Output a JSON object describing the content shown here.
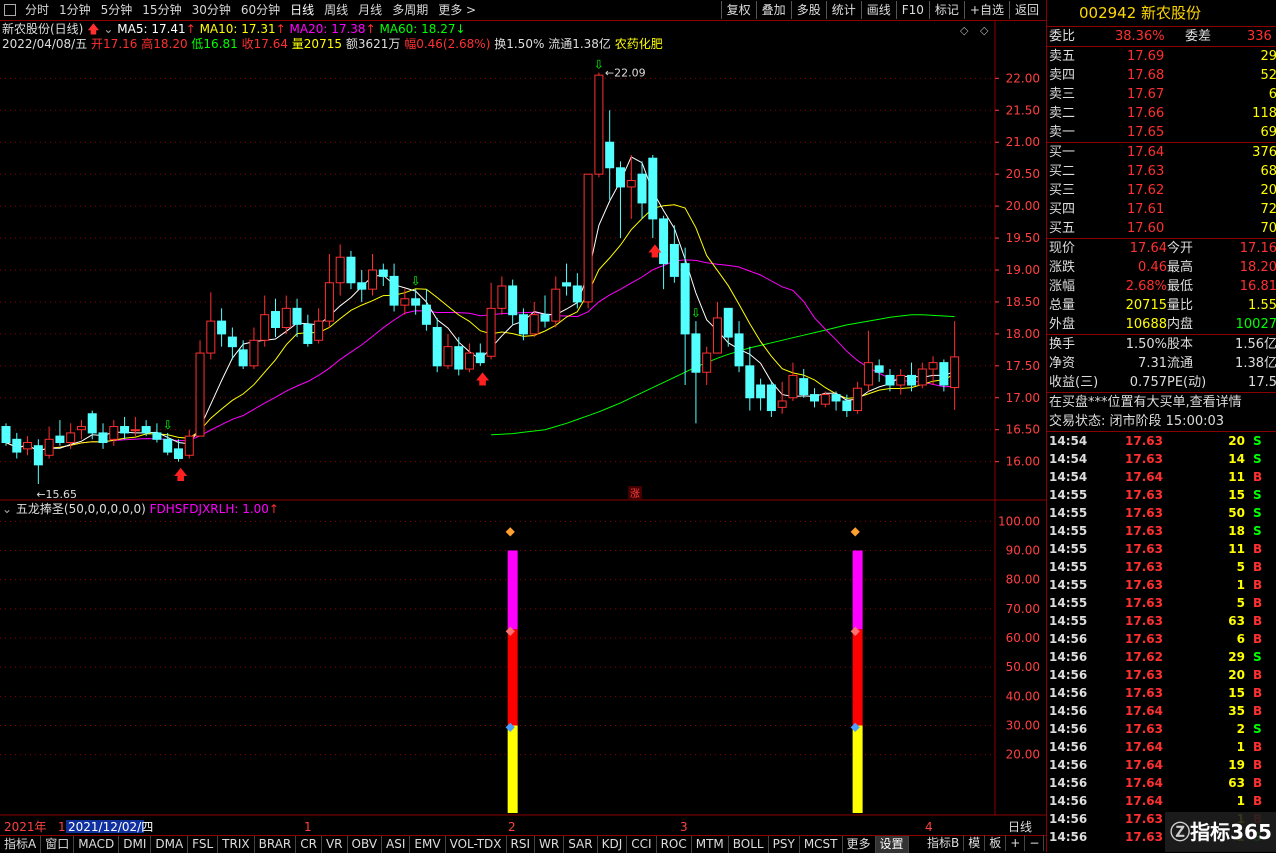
{
  "toolbar": {
    "periods": [
      "分时",
      "1分钟",
      "5分钟",
      "15分钟",
      "30分钟",
      "60分钟",
      "日线",
      "周线",
      "月线",
      "多周期",
      "更多"
    ],
    "active_period": "日线",
    "buttons": [
      "复权",
      "叠加",
      "多股",
      "统计",
      "画线",
      "F10",
      "标记",
      "+自选",
      "返回"
    ]
  },
  "chart_header": {
    "stock_label": "新农股份(日线)",
    "ma5": "MA5: 17.41",
    "ma10": "MA10: 17.31",
    "ma20": "MA20: 17.38",
    "ma60": "MA60: 18.27",
    "date": "2022/04/08/五",
    "open": "开17.16",
    "high": "高18.20",
    "low": "低16.81",
    "close": "收17.64",
    "vol": "量20715",
    "amount": "额3621万",
    "change": "幅0.46(2.68%)",
    "turnover": "换1.50%",
    "float": "流通1.38亿",
    "sector": "农药化肥"
  },
  "colors": {
    "up": "#ff3030",
    "down": "#54ffff",
    "ma5": "#ffffff",
    "ma10": "#ffff00",
    "ma20": "#ff00ff",
    "ma60": "#00ff00",
    "grid": "#8b0000",
    "axis": "#ff4040"
  },
  "price_axis": {
    "ticks": [
      22.0,
      21.5,
      21.0,
      20.5,
      20.0,
      19.5,
      19.0,
      18.5,
      18.0,
      17.5,
      17.0,
      16.5,
      16.0
    ],
    "max_label": "22.09",
    "min_label": "15.65"
  },
  "indicator": {
    "title": "五龙捧圣(50,0,0,0,0,0)",
    "value": "FDHSFDJXRLH: 1.00",
    "ticks": [
      100.0,
      90.0,
      80.0,
      70.0,
      60.0,
      50.0,
      40.0,
      30.0,
      20.0
    ],
    "bars": [
      {
        "index": 35,
        "yellow": [
          0,
          30
        ],
        "red": [
          30,
          63
        ],
        "magenta": [
          63,
          90
        ]
      },
      {
        "index": 67,
        "yellow": [
          0,
          30
        ],
        "red": [
          30,
          63
        ],
        "magenta": [
          63,
          90
        ]
      }
    ]
  },
  "chart_data": {
    "type": "candlestick",
    "candles": [
      [
        16.55,
        16.3,
        16.6,
        16.25
      ],
      [
        16.35,
        16.15,
        16.45,
        16.05
      ],
      [
        16.2,
        16.3,
        16.4,
        16.1
      ],
      [
        16.25,
        15.95,
        16.35,
        15.65
      ],
      [
        16.1,
        16.35,
        16.55,
        16.05
      ],
      [
        16.4,
        16.3,
        16.65,
        16.25
      ],
      [
        16.3,
        16.45,
        16.6,
        16.2
      ],
      [
        16.5,
        16.55,
        16.65,
        16.35
      ],
      [
        16.75,
        16.45,
        16.8,
        16.35
      ],
      [
        16.45,
        16.3,
        16.6,
        16.2
      ],
      [
        16.35,
        16.55,
        16.65,
        16.25
      ],
      [
        16.55,
        16.45,
        16.7,
        16.35
      ],
      [
        16.5,
        16.5,
        16.7,
        16.4
      ],
      [
        16.55,
        16.45,
        16.65,
        16.4
      ],
      [
        16.45,
        16.35,
        16.6,
        16.3
      ],
      [
        16.35,
        16.15,
        16.45,
        16.1
      ],
      [
        16.2,
        16.05,
        16.35,
        16.0
      ],
      [
        16.1,
        16.4,
        16.5,
        16.05
      ],
      [
        16.4,
        17.7,
        17.9,
        16.4
      ],
      [
        17.7,
        18.2,
        18.65,
        17.6
      ],
      [
        18.2,
        18.0,
        18.4,
        17.8
      ],
      [
        17.95,
        17.8,
        18.1,
        17.6
      ],
      [
        17.75,
        17.5,
        17.9,
        17.45
      ],
      [
        17.5,
        17.9,
        18.1,
        17.45
      ],
      [
        17.9,
        18.3,
        18.6,
        17.8
      ],
      [
        18.35,
        18.1,
        18.55,
        17.95
      ],
      [
        18.1,
        18.4,
        18.6,
        18.0
      ],
      [
        18.4,
        18.15,
        18.55,
        17.95
      ],
      [
        18.15,
        17.85,
        18.3,
        17.8
      ],
      [
        17.9,
        18.2,
        18.4,
        17.85
      ],
      [
        18.2,
        18.8,
        19.25,
        18.1
      ],
      [
        18.8,
        19.2,
        19.4,
        18.6
      ],
      [
        19.2,
        18.8,
        19.3,
        18.7
      ],
      [
        18.8,
        18.7,
        19.0,
        18.5
      ],
      [
        18.7,
        19.0,
        19.25,
        18.6
      ],
      [
        19.0,
        18.9,
        19.1,
        18.75
      ],
      [
        18.9,
        18.45,
        19.1,
        18.35
      ],
      [
        18.45,
        18.55,
        18.7,
        18.3
      ],
      [
        18.55,
        18.45,
        18.7,
        18.3
      ],
      [
        18.45,
        18.15,
        18.7,
        18.05
      ],
      [
        18.1,
        17.5,
        18.25,
        17.4
      ],
      [
        17.5,
        17.8,
        18.0,
        17.45
      ],
      [
        17.8,
        17.45,
        17.95,
        17.35
      ],
      [
        17.45,
        17.7,
        17.85,
        17.4
      ],
      [
        17.7,
        17.55,
        17.85,
        17.5
      ],
      [
        17.65,
        18.4,
        18.8,
        17.6
      ],
      [
        18.4,
        18.75,
        18.9,
        18.3
      ],
      [
        18.75,
        18.3,
        18.85,
        18.15
      ],
      [
        18.3,
        18.0,
        18.4,
        17.9
      ],
      [
        18.0,
        18.3,
        18.5,
        17.95
      ],
      [
        18.3,
        18.2,
        18.6,
        18.1
      ],
      [
        18.2,
        18.7,
        18.9,
        18.1
      ],
      [
        18.8,
        18.75,
        19.1,
        18.6
      ],
      [
        18.75,
        18.5,
        18.95,
        18.4
      ],
      [
        18.5,
        20.5,
        20.5,
        18.4
      ],
      [
        20.5,
        22.05,
        22.09,
        20.45
      ],
      [
        21.0,
        20.6,
        21.5,
        20.1
      ],
      [
        20.6,
        20.3,
        20.7,
        19.5
      ],
      [
        20.3,
        20.4,
        20.8,
        19.8
      ],
      [
        20.5,
        20.05,
        20.7,
        19.8
      ],
      [
        20.75,
        19.8,
        20.8,
        19.5
      ],
      [
        19.8,
        19.1,
        19.85,
        18.7
      ],
      [
        19.4,
        18.9,
        19.7,
        18.8
      ],
      [
        19.1,
        18.0,
        19.35,
        17.2
      ],
      [
        18.0,
        17.4,
        18.2,
        16.6
      ],
      [
        17.4,
        17.7,
        17.8,
        17.2
      ],
      [
        17.7,
        18.25,
        18.5,
        17.7
      ],
      [
        18.4,
        17.95,
        18.4,
        17.8
      ],
      [
        18.0,
        17.5,
        18.2,
        17.4
      ],
      [
        17.5,
        17.0,
        17.8,
        16.8
      ],
      [
        17.2,
        17.0,
        17.3,
        16.8
      ],
      [
        17.2,
        16.8,
        17.25,
        16.7
      ],
      [
        16.85,
        16.95,
        17.25,
        16.75
      ],
      [
        17.0,
        17.35,
        17.55,
        16.95
      ],
      [
        17.3,
        17.05,
        17.45,
        17.0
      ],
      [
        17.05,
        16.95,
        17.15,
        16.85
      ],
      [
        16.9,
        17.05,
        17.1,
        16.85
      ],
      [
        17.05,
        16.95,
        17.1,
        16.8
      ],
      [
        16.95,
        16.8,
        17.05,
        16.7
      ],
      [
        16.8,
        17.15,
        17.25,
        16.75
      ],
      [
        17.2,
        17.55,
        18.05,
        17.1
      ],
      [
        17.5,
        17.4,
        17.6,
        17.25
      ],
      [
        17.35,
        17.2,
        17.45,
        17.1
      ],
      [
        17.2,
        17.35,
        17.45,
        17.05
      ],
      [
        17.35,
        17.2,
        17.55,
        17.1
      ],
      [
        17.2,
        17.45,
        17.55,
        17.15
      ],
      [
        17.45,
        17.55,
        17.65,
        17.2
      ],
      [
        17.55,
        17.2,
        17.6,
        17.1
      ],
      [
        17.16,
        17.64,
        18.2,
        16.81
      ]
    ],
    "ma60": [
      16.42,
      16.43,
      16.44,
      16.46,
      16.48,
      16.5,
      16.55,
      16.6,
      16.66,
      16.72,
      16.78,
      16.85,
      16.92,
      17.0,
      17.08,
      17.16,
      17.24,
      17.32,
      17.4,
      17.48,
      17.55,
      17.62,
      17.68,
      17.73,
      17.78,
      17.82,
      17.86,
      17.9,
      17.94,
      17.98,
      18.02,
      18.06,
      18.1,
      18.14,
      18.17,
      18.2,
      18.23,
      18.26,
      18.28,
      18.3,
      18.3,
      18.29,
      18.28,
      18.27
    ]
  },
  "right_panel": {
    "code": "002942",
    "name": "新农股份",
    "weibi_label": "委比",
    "weibi_value": "38.36%",
    "weicha_label": "委差",
    "weicha_value": "336",
    "asks": [
      [
        "卖五",
        "17.69",
        "29"
      ],
      [
        "卖四",
        "17.68",
        "52"
      ],
      [
        "卖三",
        "17.67",
        "6"
      ],
      [
        "卖二",
        "17.66",
        "118"
      ],
      [
        "卖一",
        "17.65",
        "69"
      ]
    ],
    "bids": [
      [
        "买一",
        "17.64",
        "376"
      ],
      [
        "买二",
        "17.63",
        "68"
      ],
      [
        "买三",
        "17.62",
        "20"
      ],
      [
        "买四",
        "17.61",
        "72"
      ],
      [
        "买五",
        "17.60",
        "70"
      ]
    ],
    "quote": [
      [
        "现价",
        "17.64",
        "今开",
        "17.16"
      ],
      [
        "涨跌",
        "0.46",
        "最高",
        "18.20"
      ],
      [
        "涨幅",
        "2.68%",
        "最低",
        "16.81"
      ],
      [
        "总量",
        "20715",
        "量比",
        "1.55"
      ],
      [
        "外盘",
        "10688",
        "内盘",
        "10027"
      ]
    ],
    "fundamentals": [
      [
        "换手",
        "1.50%",
        "股本",
        "1.56亿"
      ],
      [
        "净资",
        "7.31",
        "流通",
        "1.38亿"
      ],
      [
        "收益(三)",
        "0.757",
        "PE(动)",
        "17.5"
      ]
    ],
    "notice": "在买盘***位置有大买单,查看详情",
    "status": "交易状态: 闭市阶段 15:00:03",
    "ticks": [
      [
        "14:54",
        "17.63",
        "20",
        "S"
      ],
      [
        "14:54",
        "17.63",
        "14",
        "S"
      ],
      [
        "14:54",
        "17.64",
        "11",
        "B"
      ],
      [
        "14:55",
        "17.63",
        "15",
        "S"
      ],
      [
        "14:55",
        "17.63",
        "50",
        "S"
      ],
      [
        "14:55",
        "17.63",
        "18",
        "S"
      ],
      [
        "14:55",
        "17.63",
        "11",
        "B"
      ],
      [
        "14:55",
        "17.63",
        "5",
        "B"
      ],
      [
        "14:55",
        "17.63",
        "1",
        "B"
      ],
      [
        "14:55",
        "17.63",
        "5",
        "B"
      ],
      [
        "14:55",
        "17.63",
        "63",
        "B"
      ],
      [
        "14:56",
        "17.63",
        "6",
        "B"
      ],
      [
        "14:56",
        "17.62",
        "29",
        "S"
      ],
      [
        "14:56",
        "17.63",
        "20",
        "B"
      ],
      [
        "14:56",
        "17.63",
        "15",
        "B"
      ],
      [
        "14:56",
        "17.64",
        "35",
        "B"
      ],
      [
        "14:56",
        "17.63",
        "2",
        "S"
      ],
      [
        "14:56",
        "17.64",
        "1",
        "B"
      ],
      [
        "14:56",
        "17.64",
        "19",
        "B"
      ],
      [
        "14:56",
        "17.64",
        "63",
        "B"
      ],
      [
        "14:56",
        "17.64",
        "1",
        "B"
      ],
      [
        "14:56",
        "17.63",
        "1",
        "B"
      ],
      [
        "14:56",
        "17.63",
        "1",
        "S"
      ]
    ]
  },
  "time_axis": {
    "labels": [
      "2021年",
      "1",
      "2021/12/02/四",
      "1",
      "2",
      "3",
      "4"
    ],
    "right_label": "日线"
  },
  "bottom_tabs": [
    "指标A",
    "窗口",
    "MACD",
    "DMI",
    "DMA",
    "FSL",
    "TRIX",
    "BRAR",
    "CR",
    "VR",
    "OBV",
    "ASI",
    "EMV",
    "VOL-TDX",
    "RSI",
    "WR",
    "SAR",
    "KDJ",
    "CCI",
    "ROC",
    "MTM",
    "BOLL",
    "PSY",
    "MCST",
    "更多",
    "设置"
  ],
  "bottom_right": [
    "指标B",
    "模",
    "板",
    "+",
    "−"
  ],
  "watermark": "指标365"
}
